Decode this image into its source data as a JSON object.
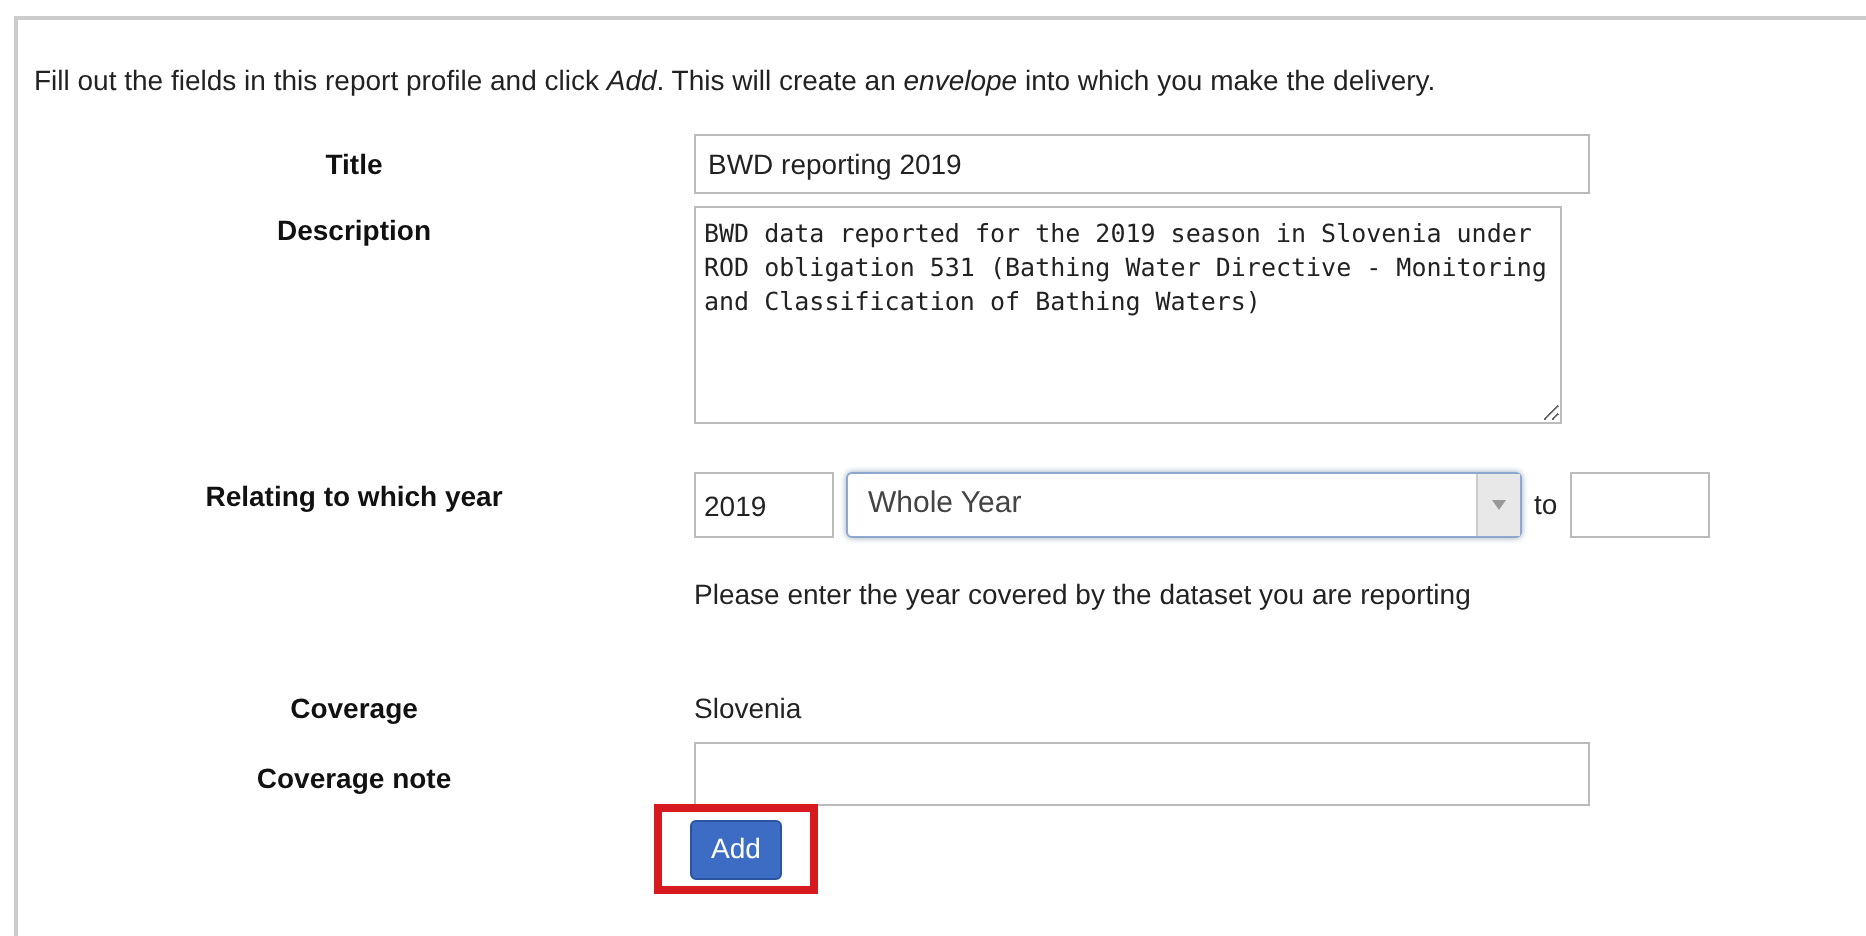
{
  "intro": "Fill out the fields in this report profile and click *Add*. This will create an *envelope* into which you make the delivery.",
  "title": {
    "label": "Title",
    "value": "BWD reporting 2019"
  },
  "description": {
    "label": "Description",
    "value": "BWD data reported for the 2019 season in Slovenia under ROD obligation 531 (Bathing Water Directive - Monitoring and Classification of Bathing Waters)"
  },
  "year": {
    "label": "Relating to which year",
    "from": "2019",
    "period": "Whole Year",
    "to_label": "to",
    "hint": "Please enter the year covered by the dataset you are reporting"
  },
  "coverage": {
    "label": "Coverage",
    "value": "Slovenia"
  },
  "coverage_note": {
    "label": "Coverage note"
  },
  "add_button": {
    "label": "Add",
    "highlighted": true
  }
}
